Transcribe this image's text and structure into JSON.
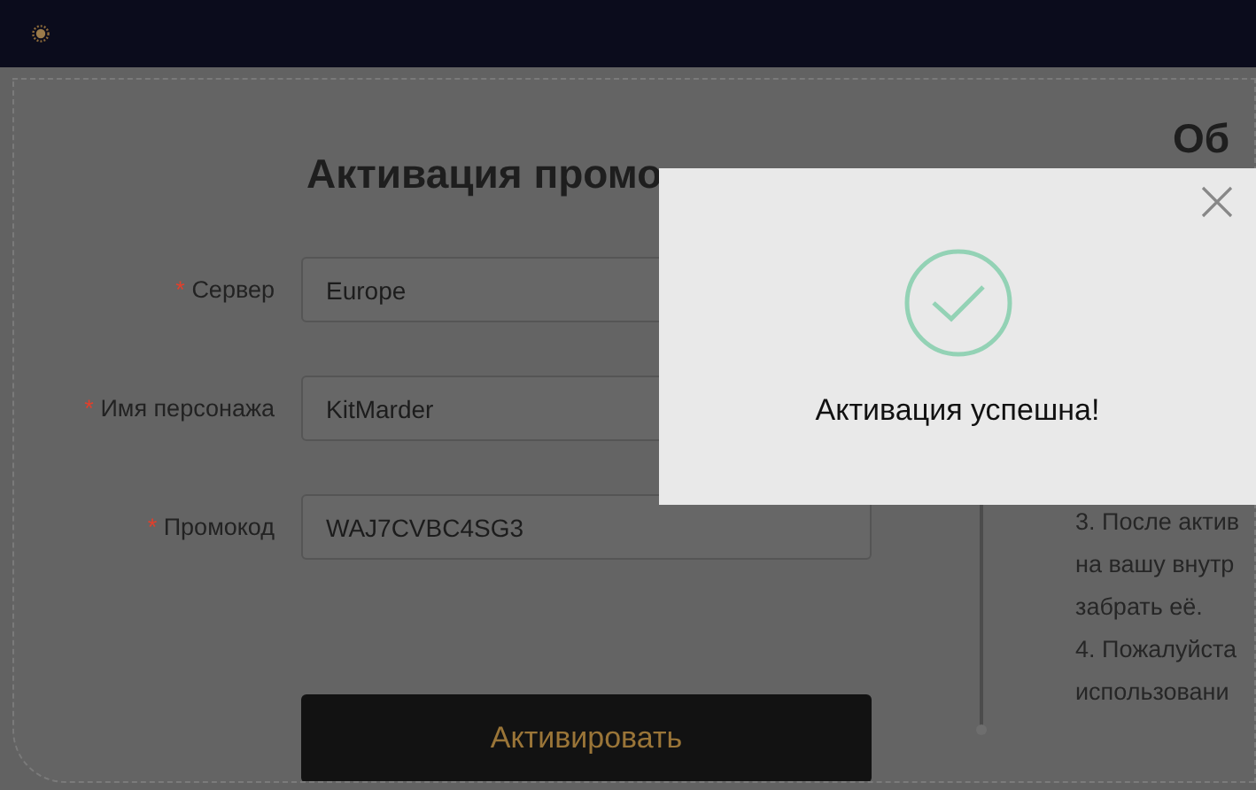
{
  "form": {
    "title": "Активация промо",
    "fields": [
      {
        "mark": "*",
        "label": "Сервер",
        "value": "Europe"
      },
      {
        "mark": "*",
        "label": "Имя персонажа",
        "value": "KitMarder"
      },
      {
        "mark": "*",
        "label": "Промокод",
        "value": "WAJ7CVBC4SG3"
      }
    ],
    "button": "Активировать"
  },
  "info": {
    "title": "Об",
    "lines": [
      "3. После актив",
      "на вашу внутр",
      "забрать её.",
      "4. Пожалуйста",
      "использовани"
    ]
  },
  "modal": {
    "message": "Активация успешна!"
  }
}
